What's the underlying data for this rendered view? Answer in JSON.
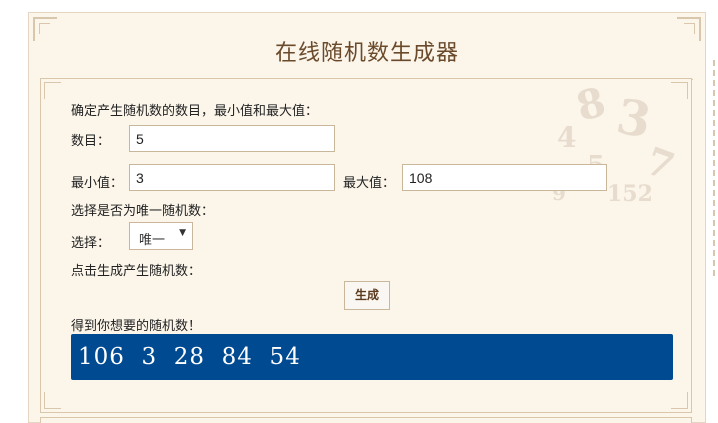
{
  "page": {
    "title": "在线随机数生成器"
  },
  "form": {
    "intro": "确定产生随机数的数目，最小值和最大值：",
    "count_label": "数目：",
    "count_value": "5",
    "min_label": "最小值：",
    "min_value": "3",
    "max_label": "最大值：",
    "max_value": "108",
    "unique_prompt": "选择是否为唯一随机数：",
    "choice_label": "选择：",
    "choice_selected": "唯一",
    "generate_prompt": "点击生成产生随机数：",
    "generate_button": "生成",
    "result_label": "得到你想要的随机数！",
    "result_values": "106  3  28  84  54"
  },
  "colors": {
    "background": "#fbf5ea",
    "title": "#6b4a2b",
    "border": "#d9c6ab",
    "result_bg": "#004a92",
    "result_text": "#ffffff"
  }
}
